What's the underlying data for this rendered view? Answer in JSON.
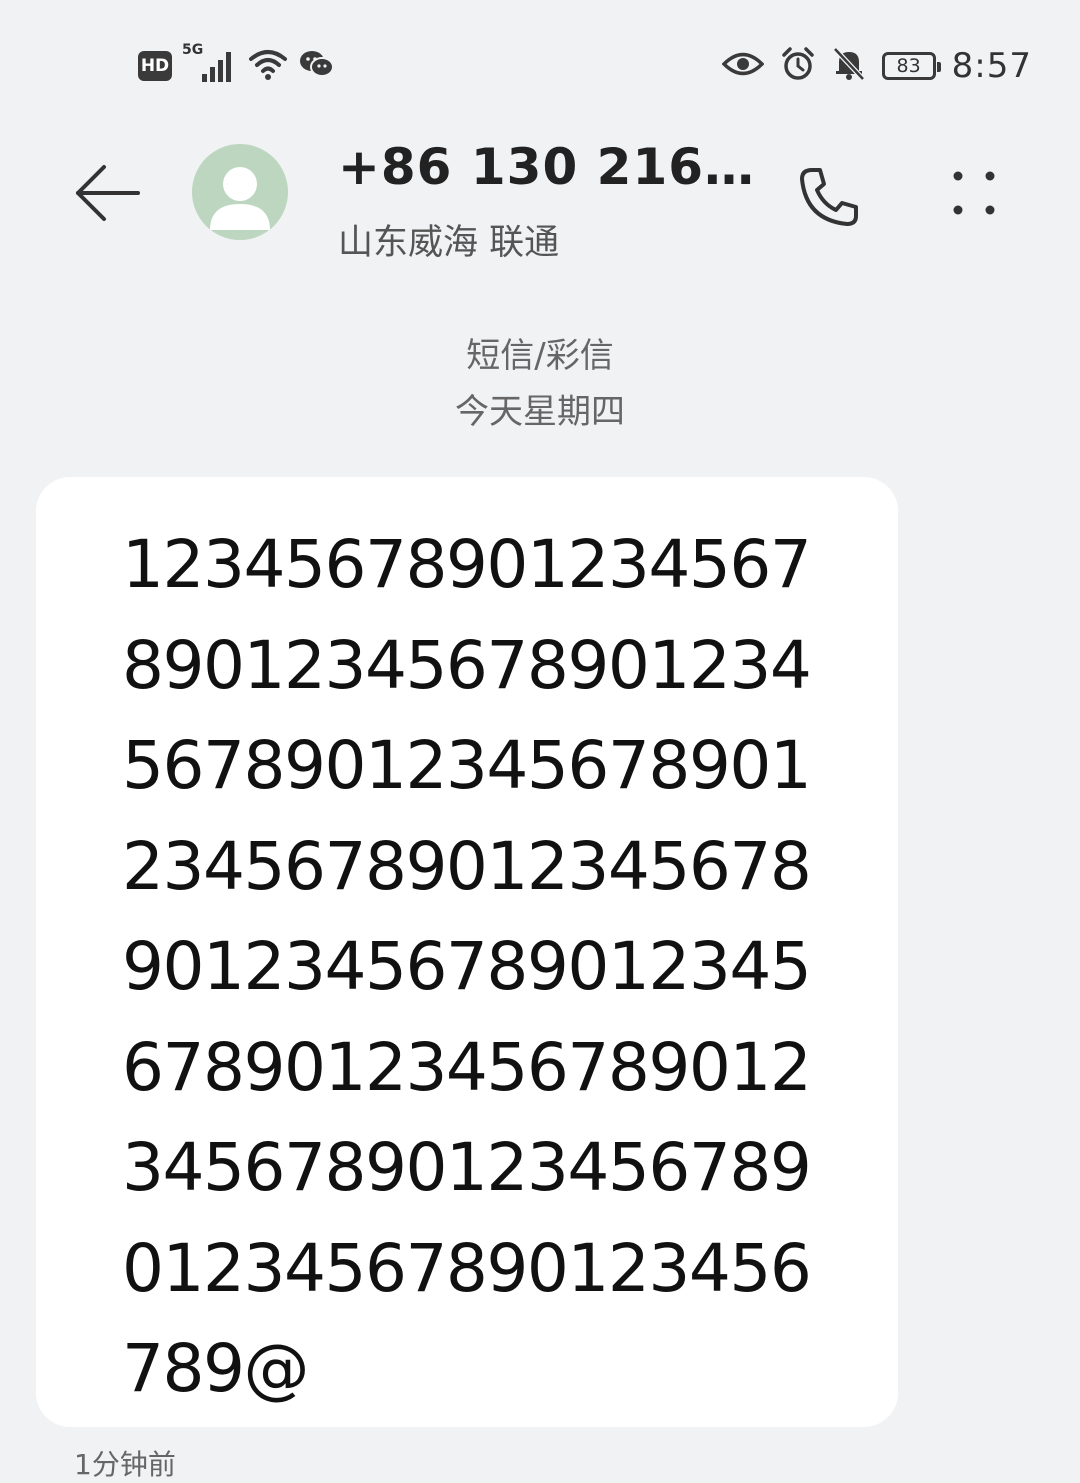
{
  "status_bar": {
    "hd_label": "HD",
    "network_label": "5G",
    "battery_level": "83",
    "time": "8:57",
    "icons": [
      "signal-icon",
      "wifi-icon",
      "wechat-icon",
      "eye-icon",
      "alarm-icon",
      "mute-bell-icon"
    ]
  },
  "header": {
    "contact_name": "+86 130 216…",
    "contact_location": "山东威海 联通"
  },
  "conversation": {
    "channel_label": "短信/彩信",
    "date_label": "今天星期四"
  },
  "message": {
    "lines": [
      "12345678901234567",
      "89012345678901234",
      "56789012345678901",
      "23456789012345678",
      "90123456789012345",
      "67890123456789012",
      "34567890123456789",
      "01234567890123456",
      "789@"
    ],
    "time_ago": "1分钟前"
  },
  "colors": {
    "background": "#f1f2f4",
    "bubble": "#ffffff",
    "avatar": "#bcd6bf"
  }
}
